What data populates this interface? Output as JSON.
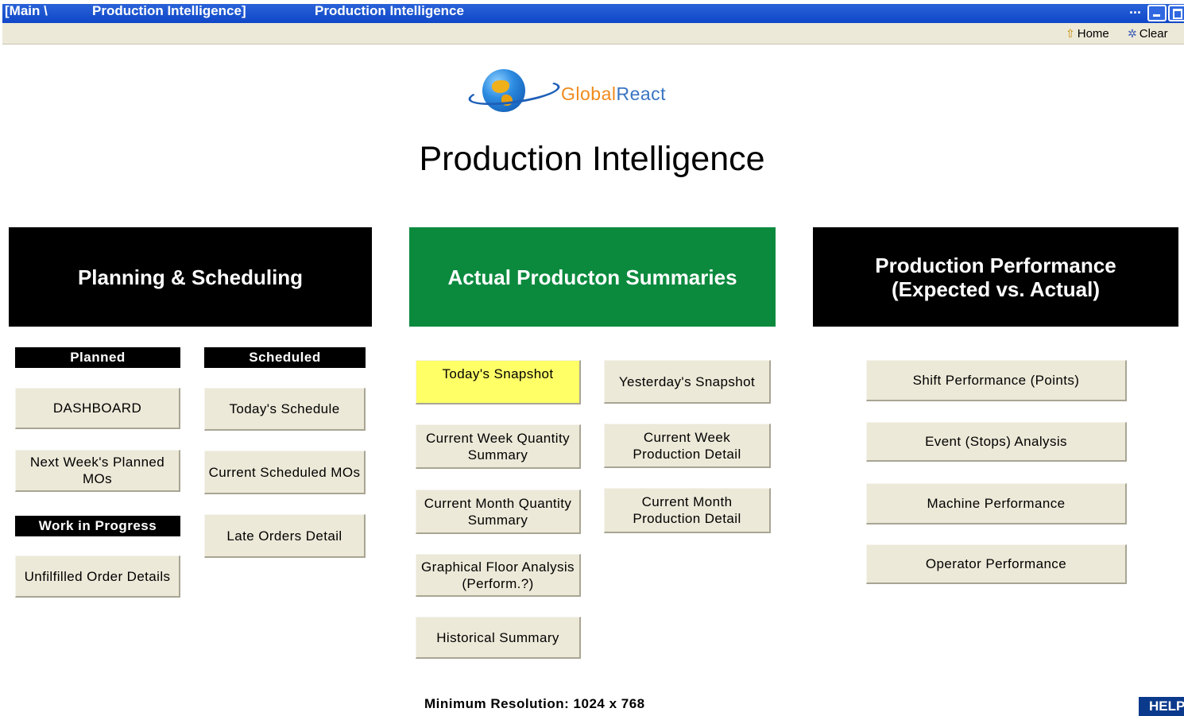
{
  "window": {
    "tab1": "[Main \\",
    "tab2": "Production Intelligence]",
    "title": "Production Intelligence",
    "dots": "..."
  },
  "toolbar": {
    "home_label": "Home",
    "clear_label": "Clear"
  },
  "logo": {
    "text_part1": "Global",
    "text_part2": "React"
  },
  "page_title": "Production Intelligence",
  "sections": {
    "planning": {
      "title": "Planning & Scheduling",
      "planned_header": "Planned",
      "scheduled_header": "Scheduled",
      "wip_header": "Work in Progress",
      "dashboard": "DASHBOARD",
      "next_week": "Next Week's Planned MOs",
      "unfilled": "Unfilfilled Order Details",
      "todays_schedule": "Today's Schedule",
      "current_scheduled": "Current Scheduled MOs",
      "late_orders": "Late Orders Detail"
    },
    "actual": {
      "title": "Actual Producton Summaries",
      "todays_snapshot": "Today's Snapshot",
      "yesterdays_snapshot": "Yesterday's Snapshot",
      "cw_qty": "Current Week Quantity Summary",
      "cw_prod": "Current Week Production Detail",
      "cm_qty": "Current Month Quantity Summary",
      "cm_prod": "Current Month Production Detail",
      "floor": "Graphical Floor Analysis (Perform.?)",
      "historical": "Historical Summary"
    },
    "performance": {
      "title_line1": "Production Performance",
      "title_line2": "(Expected vs. Actual)",
      "shift": "Shift Performance (Points)",
      "event": "Event (Stops) Analysis",
      "machine": "Machine Performance",
      "operator": "Operator Performance"
    }
  },
  "footer": {
    "min_resolution": "Minimum Resolution: 1024 x 768",
    "help": "HELP"
  },
  "colors": {
    "titlebar": "#0f47c8",
    "green_section": "#0b8a3e",
    "button_bg": "#ece9d8",
    "highlight": "#ffff66"
  }
}
